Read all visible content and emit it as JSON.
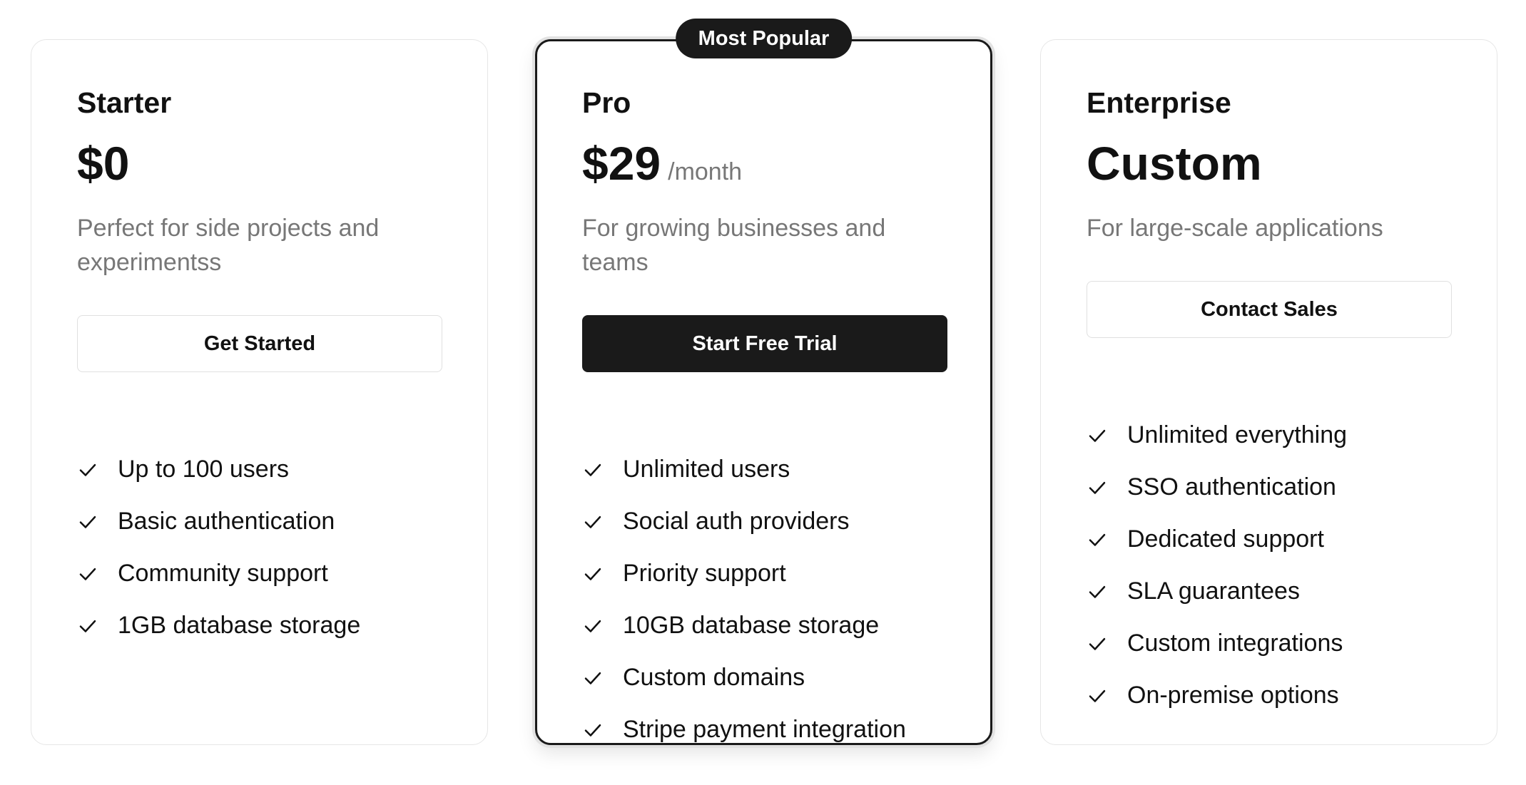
{
  "plans": [
    {
      "name": "Starter",
      "price": "$0",
      "period": "",
      "description": "Perfect for side projects and experimentss",
      "cta_label": "Get Started",
      "features": [
        "Up to 100 users",
        "Basic authentication",
        "Community support",
        "1GB database storage"
      ]
    },
    {
      "badge": "Most Popular",
      "name": "Pro",
      "price": "$29",
      "period": "/month",
      "description": "For growing businesses and teams",
      "cta_label": "Start Free Trial",
      "features": [
        "Unlimited users",
        "Social auth providers",
        "Priority support",
        "10GB database storage",
        "Custom domains",
        "Stripe payment integration"
      ]
    },
    {
      "name": "Enterprise",
      "price": "Custom",
      "period": "",
      "description": "For large-scale applications",
      "cta_label": "Contact Sales",
      "features": [
        "Unlimited everything",
        "SSO authentication",
        "Dedicated support",
        "SLA guarantees",
        "Custom integrations",
        "On-premise options"
      ]
    }
  ],
  "icons": {
    "feature_bullet": "check-icon"
  },
  "colors": {
    "primary": "#1a1a1a",
    "muted_text": "#777777",
    "border": "#e6e6e6",
    "background": "#ffffff"
  }
}
